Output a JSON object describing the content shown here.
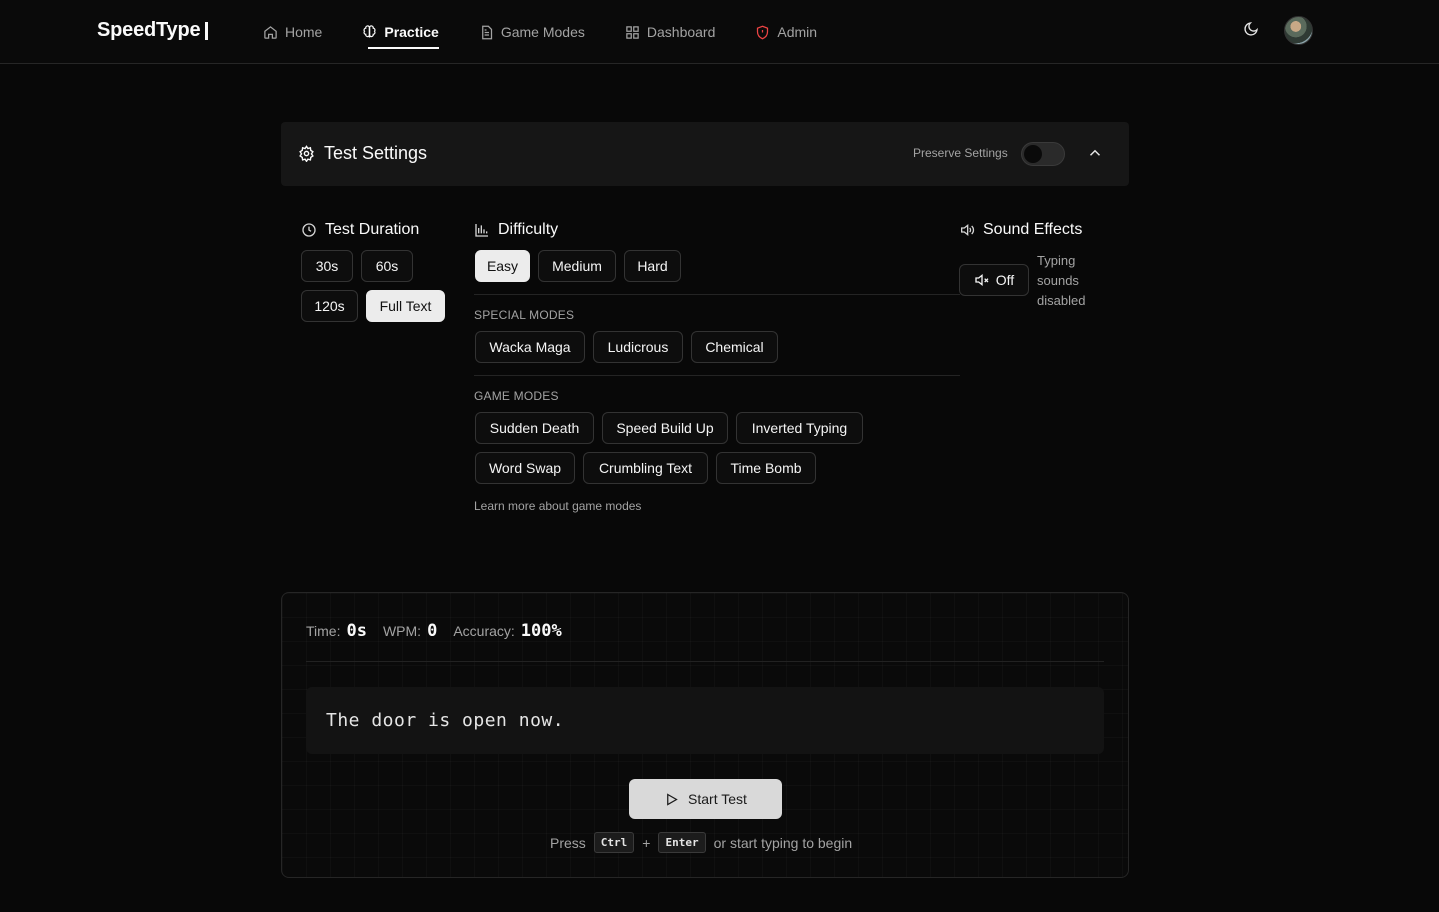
{
  "nav": {
    "logo": "SpeedType",
    "links": [
      {
        "label": "Home",
        "icon": "home-icon"
      },
      {
        "label": "Practice",
        "icon": "brain-icon"
      },
      {
        "label": "Game Modes",
        "icon": "document-icon"
      },
      {
        "label": "Dashboard",
        "icon": "grid-icon"
      },
      {
        "label": "Admin",
        "icon": "shield-icon"
      }
    ],
    "active_link": "Practice",
    "theme_icon": "moon-icon"
  },
  "settings": {
    "title": "Test Settings",
    "preserve_label": "Preserve Settings",
    "preserve_on": false,
    "duration": {
      "title": "Test Duration",
      "options": [
        "30s",
        "60s",
        "120s",
        "Full Text"
      ],
      "selected": "Full Text"
    },
    "difficulty": {
      "title": "Difficulty",
      "options": [
        "Easy",
        "Medium",
        "Hard"
      ],
      "selected": "Easy"
    },
    "special_modes": {
      "title": "SPECIAL MODES",
      "options": [
        "Wacka Maga",
        "Ludicrous",
        "Chemical"
      ]
    },
    "game_modes": {
      "title": "GAME MODES",
      "options": [
        "Sudden Death",
        "Speed Build Up",
        "Inverted Typing",
        "Word Swap",
        "Crumbling Text",
        "Time Bomb"
      ],
      "learn_more": "Learn more about game modes"
    },
    "sound": {
      "title": "Sound Effects",
      "button_label": "Off",
      "note": "Typing sounds disabled"
    }
  },
  "test": {
    "time_label": "Time:",
    "time_value": "0s",
    "wpm_label": "WPM:",
    "wpm_value": "0",
    "accuracy_label": "Accuracy:",
    "accuracy_value": "100%",
    "text": "The door is open now.",
    "start_label": "Start Test",
    "hint_press": "Press",
    "hint_key1": "Ctrl",
    "hint_plus": "+",
    "hint_key2": "Enter",
    "hint_rest": "or start typing to begin"
  },
  "colors": {
    "background": "#080808",
    "panel": "#161616",
    "accent_selected": "#ececec",
    "admin_icon": "#ef4444"
  }
}
